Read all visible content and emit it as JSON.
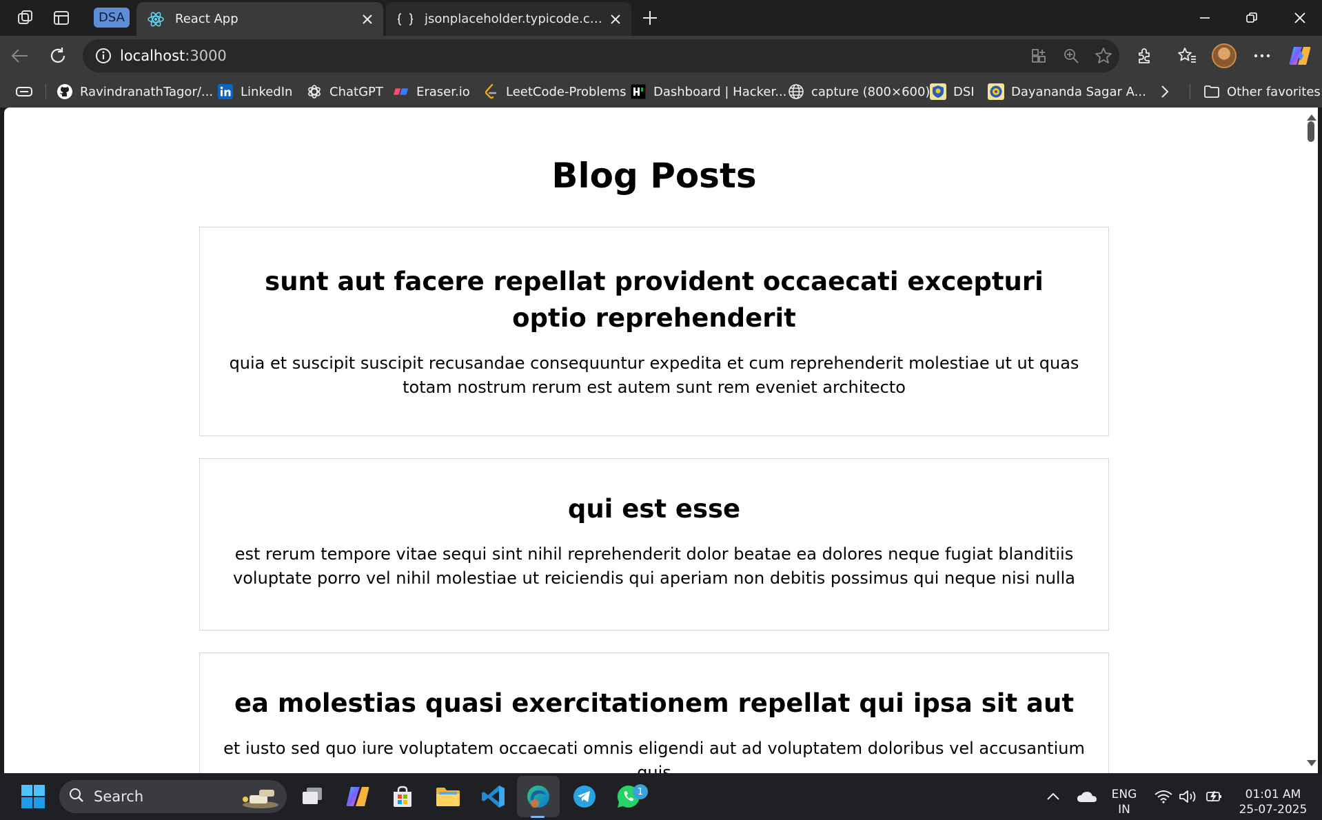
{
  "tabs": {
    "group_label": "DSA",
    "active": {
      "title": "React App"
    },
    "inactive": {
      "title": "jsonplaceholder.typicode.com/po"
    }
  },
  "address_bar": {
    "host": "localhost",
    "port": ":3000"
  },
  "favorites": [
    {
      "label": "RavindranathTagor/...",
      "icon": "github-icon"
    },
    {
      "label": "LinkedIn",
      "icon": "linkedin-icon"
    },
    {
      "label": "ChatGPT",
      "icon": "chatgpt-icon"
    },
    {
      "label": "Eraser.io",
      "icon": "eraser-icon"
    },
    {
      "label": "LeetCode-Problems",
      "icon": "leetcode-icon"
    },
    {
      "label": "Dashboard | Hacker...",
      "icon": "hackerrank-icon"
    },
    {
      "label": "capture (800×600)",
      "icon": "globe-icon"
    },
    {
      "label": "DSI",
      "icon": "dsi-icon"
    },
    {
      "label": "Dayananda Sagar A...",
      "icon": "college-icon"
    }
  ],
  "other_favorites": "Other favorites",
  "page": {
    "title": "Blog Posts",
    "posts": [
      {
        "title": "sunt aut facere repellat provident occaecati excepturi optio reprehenderit",
        "body": "quia et suscipit suscipit recusandae consequuntur expedita et cum reprehenderit molestiae ut ut quas totam nostrum rerum est autem sunt rem eveniet architecto"
      },
      {
        "title": "qui est esse",
        "body": "est rerum tempore vitae sequi sint nihil reprehenderit dolor beatae ea dolores neque fugiat blanditiis voluptate porro vel nihil molestiae ut reiciendis qui aperiam non debitis possimus qui neque nisi nulla"
      },
      {
        "title": "ea molestias quasi exercitationem repellat qui ipsa sit aut",
        "body": "et iusto sed quo iure voluptatem occaecati omnis eligendi aut ad voluptatem doloribus vel accusantium quis"
      }
    ]
  },
  "taskbar": {
    "search_label": "Search",
    "whatsapp_badge": "1",
    "language_top": "ENG",
    "language_bottom": "IN",
    "time": "01:01 AM",
    "date": "25-07-2025"
  },
  "colors": {
    "accent_group": "#5d8fd8",
    "page_bg": "#ffffff",
    "card_border": "#d6d6d6"
  }
}
